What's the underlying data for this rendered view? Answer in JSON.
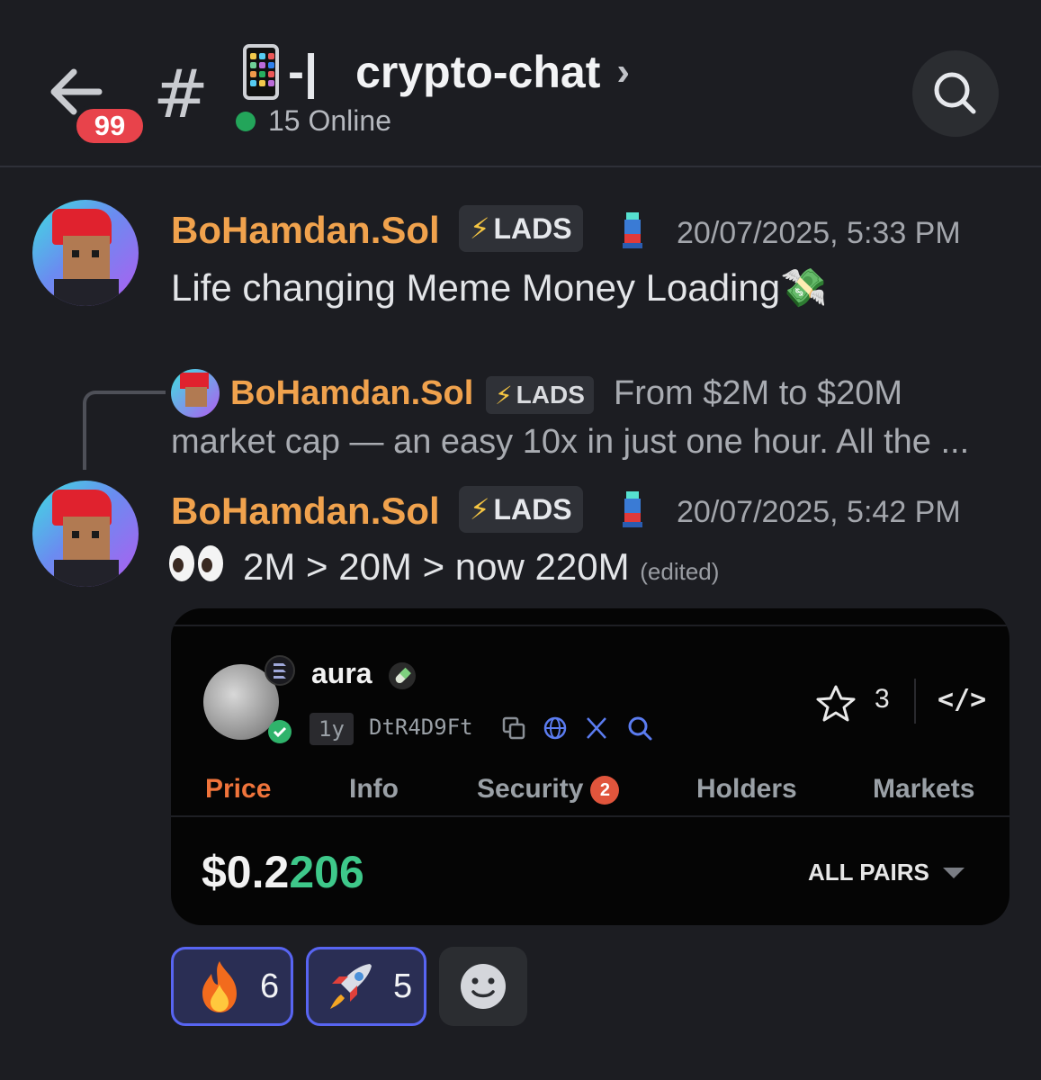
{
  "header": {
    "unread_count": "99",
    "hash": "#",
    "channel_separator": "-|",
    "channel_name": "crypto-chat",
    "chevron": "›",
    "online_text": "15 Online"
  },
  "messages": [
    {
      "author": "BoHamdan.Sol",
      "tag": "LADS",
      "timestamp": "20/07/2025, 5:33 PM",
      "text": "Life changing Meme Money Loading💸"
    },
    {
      "reply": {
        "author": "BoHamdan.Sol",
        "tag": "LADS",
        "text_line1": "From $2M to $20M",
        "text_line2": "market cap — an easy 10x in just one hour. All the ..."
      },
      "author": "BoHamdan.Sol",
      "tag": "LADS",
      "timestamp": "20/07/2025, 5:42 PM",
      "text": "2M > 20M > now 220M",
      "edited": "(edited)"
    }
  ],
  "embed": {
    "token_name": "aura",
    "age": "1y",
    "address": "DtR4D9Ft",
    "watchers": "3",
    "code_label": "</>",
    "tabs": [
      {
        "label": "Price",
        "active": true
      },
      {
        "label": "Info"
      },
      {
        "label": "Security",
        "badge": "2"
      },
      {
        "label": "Holders"
      },
      {
        "label": "Markets"
      }
    ],
    "price_prefix": "$0.2",
    "price_suffix": "206",
    "pairs_label": "ALL PAIRS"
  },
  "reactions": [
    {
      "emoji": "🔥",
      "count": "6"
    },
    {
      "emoji": "🚀",
      "count": "5"
    }
  ],
  "colors": {
    "background": "#1c1d22",
    "username": "#f0a24d",
    "active_tab": "#f0743b",
    "price_green": "#3ec88a",
    "badge_red": "#e8434b",
    "online_green": "#23a55a",
    "reaction_border": "#5865f2"
  }
}
